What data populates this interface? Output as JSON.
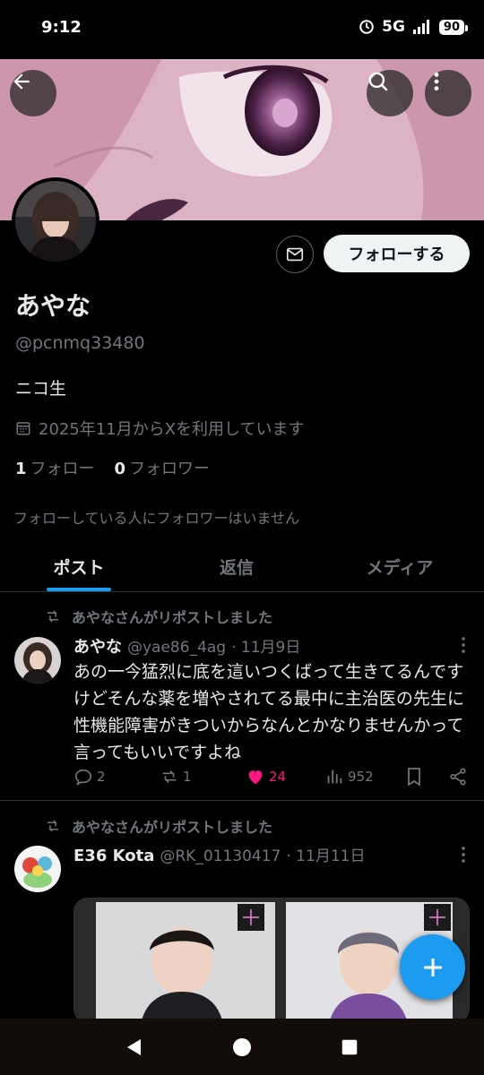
{
  "status_bar": {
    "time": "9:12",
    "network": "5G",
    "battery": "90"
  },
  "profile": {
    "follow_label": "フォローする",
    "name": "あやな",
    "handle": "@pcnmq33480",
    "bio": "ニコ生",
    "joined": "2025年11月からXを利用しています",
    "following_count": "1",
    "following_label": "フォロー",
    "followers_count": "0",
    "followers_label": "フォロワー",
    "no_mutuals_text": "フォローしている人にフォロワーはいません"
  },
  "tabs": [
    {
      "label": "ポスト",
      "active": true
    },
    {
      "label": "返信",
      "active": false
    },
    {
      "label": "メディア",
      "active": false
    }
  ],
  "posts": [
    {
      "repost_text": "あやなさんがリポストしました",
      "name": "あやな",
      "handle": "@yae86_4ag",
      "date": "· 11月9日",
      "text": "あの一今猛烈に底を這いつくばって生きてるんですけどそんな薬を増やされてる最中に主治医の先生に性機能障害がきついからなんとかなりませんかって言ってもいいですよね",
      "replies": "2",
      "reposts": "1",
      "likes": "24",
      "views": "952"
    },
    {
      "repost_text": "あやなさんがリポストしました",
      "name": "E36 Kota",
      "handle": "@RK_01130417",
      "date": "· 11月11日"
    }
  ],
  "colors": {
    "accent": "#1d9bf0",
    "like": "#f91880",
    "muted": "#71767b"
  }
}
